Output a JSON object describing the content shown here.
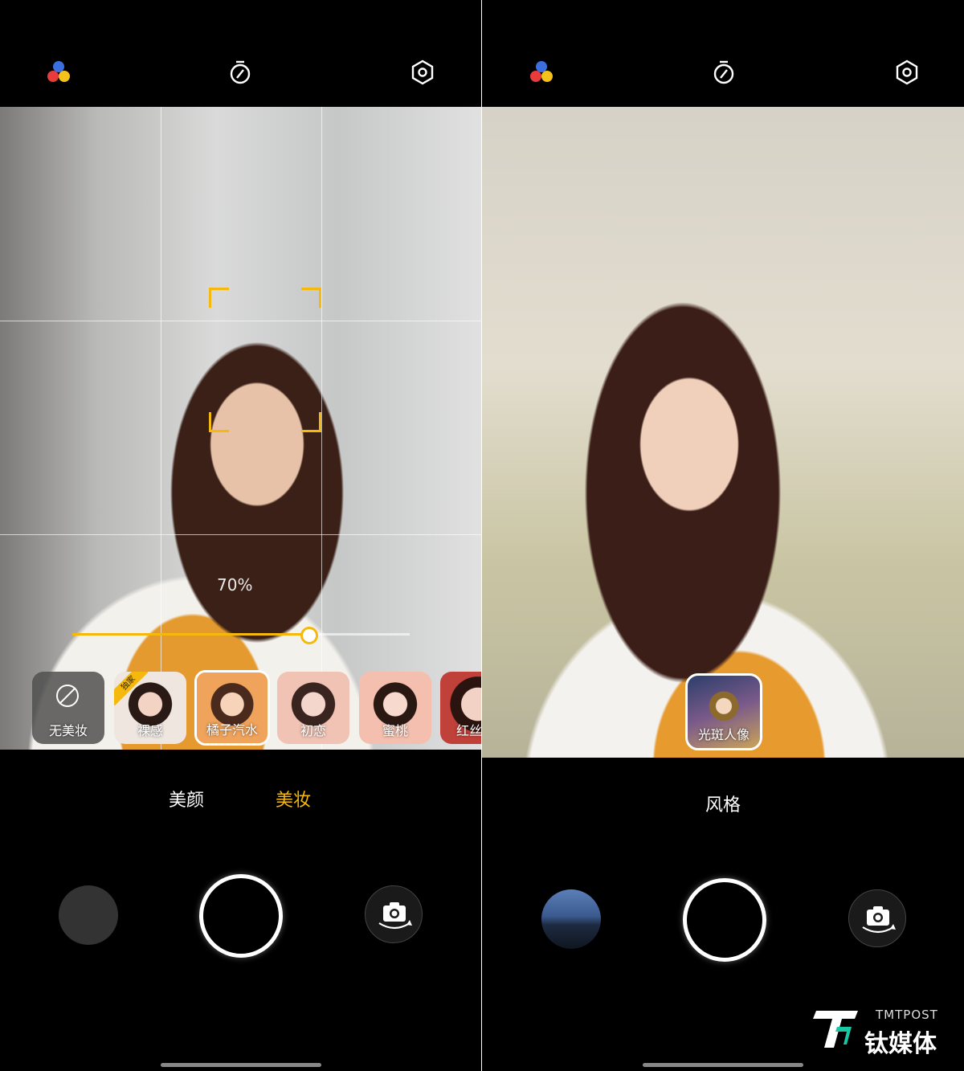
{
  "left_screen": {
    "topbar": {
      "icons": [
        "color-dots-icon",
        "timer-icon",
        "settings-hexagon-icon"
      ]
    },
    "intensity_label": "70%",
    "slider_value": 0.7,
    "makeup_items": [
      {
        "label": "无美妆",
        "type": "none"
      },
      {
        "label": "裸感",
        "badge": "独家"
      },
      {
        "label": "橘子汽水",
        "selected": true
      },
      {
        "label": "初恋"
      },
      {
        "label": "蜜桃"
      },
      {
        "label": "红丝"
      }
    ],
    "modes": [
      {
        "label": "美颜",
        "active": false
      },
      {
        "label": "美妆",
        "active": true
      }
    ]
  },
  "right_screen": {
    "topbar": {
      "icons": [
        "color-dots-icon",
        "timer-icon",
        "settings-hexagon-icon"
      ]
    },
    "style_tile_label": "光斑人像",
    "mode_label": "风格"
  },
  "watermark": {
    "en": "TMTPOST",
    "cn": "钛媒体"
  },
  "colors": {
    "accent": "#f5b90d",
    "background": "#000000",
    "text": "#ffffff"
  }
}
